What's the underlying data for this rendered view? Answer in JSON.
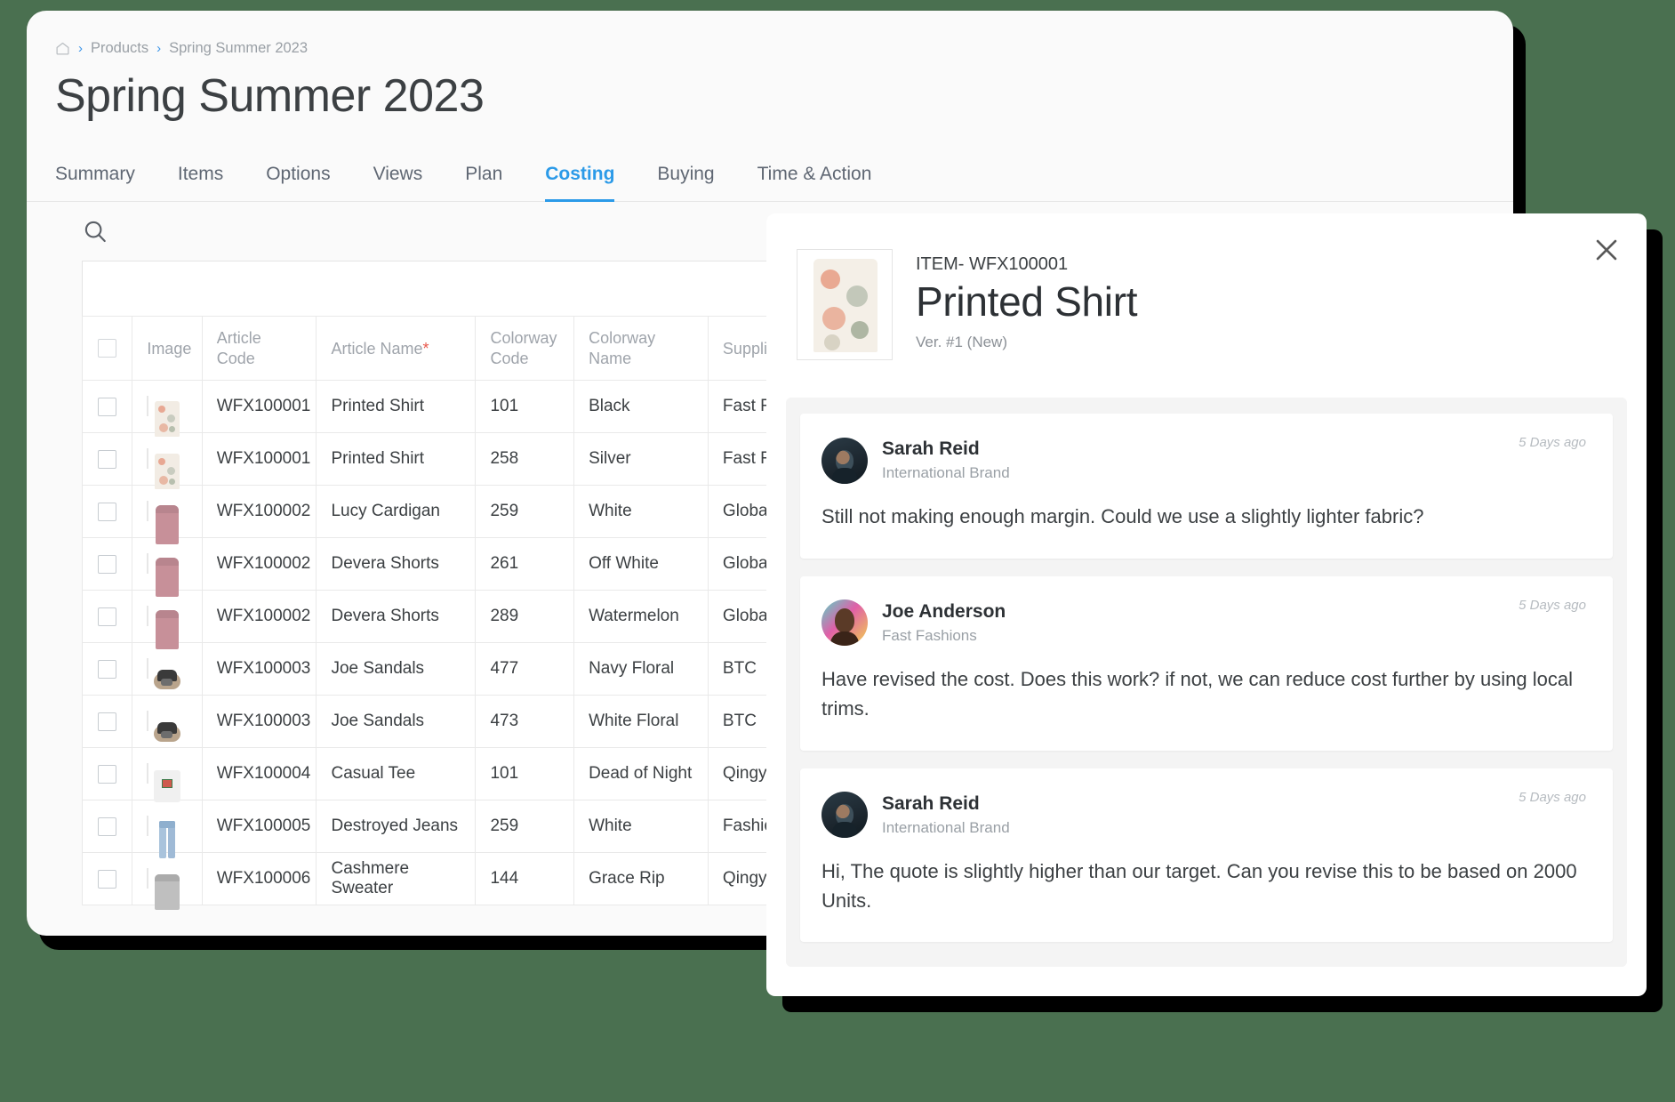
{
  "theme": {
    "background": "#4a7050",
    "accent": "#2b9ae8",
    "required_marker": "#e8584c"
  },
  "breadcrumb": {
    "home_icon": "home-icon",
    "separator": "›",
    "items": [
      "Products",
      "Spring Summer 2023"
    ]
  },
  "header": {
    "title": "Spring Summer 2023"
  },
  "tabs": [
    {
      "label": "Summary",
      "active": false
    },
    {
      "label": "Items",
      "active": false
    },
    {
      "label": "Options",
      "active": false
    },
    {
      "label": "Views",
      "active": false
    },
    {
      "label": "Plan",
      "active": false
    },
    {
      "label": "Costing",
      "active": true
    },
    {
      "label": "Buying",
      "active": false
    },
    {
      "label": "Time & Action",
      "active": false
    }
  ],
  "toolbar": {
    "search_icon": "search-icon"
  },
  "grid": {
    "columns": [
      {
        "key": "check",
        "label": ""
      },
      {
        "key": "image",
        "label": "Image"
      },
      {
        "key": "article_code",
        "label": "Article Code"
      },
      {
        "key": "article_name",
        "label": "Article Name",
        "required": true
      },
      {
        "key": "colorway_code",
        "label": "Colorway Code"
      },
      {
        "key": "colorway_name",
        "label": "Colorway Name"
      },
      {
        "key": "supplier",
        "label": "Supplier",
        "required": true
      }
    ],
    "rows": [
      {
        "thumb": "t-shirt",
        "article_code": "WFX100001",
        "article_name": "Printed Shirt",
        "colorway_code": "101",
        "colorway_name": "Black",
        "supplier": "Fast Fashions"
      },
      {
        "thumb": "t-shirt",
        "article_code": "WFX100001",
        "article_name": "Printed Shirt",
        "colorway_code": "258",
        "colorway_name": "Silver",
        "supplier": "Fast Fashions"
      },
      {
        "thumb": "t-cardigan",
        "article_code": "WFX100002",
        "article_name": "Lucy Cardigan",
        "colorway_code": "259",
        "colorway_name": "White",
        "supplier": "Global Fashions"
      },
      {
        "thumb": "t-cardigan",
        "article_code": "WFX100002",
        "article_name": "Devera Shorts",
        "colorway_code": "261",
        "colorway_name": "Off White",
        "supplier": "Global Fashions"
      },
      {
        "thumb": "t-cardigan",
        "article_code": "WFX100002",
        "article_name": "Devera Shorts",
        "colorway_code": "289",
        "colorway_name": "Watermelon",
        "supplier": "Global Fashions"
      },
      {
        "thumb": "t-sandal",
        "article_code": "WFX100003",
        "article_name": "Joe Sandals",
        "colorway_code": "477",
        "colorway_name": "Navy Floral",
        "supplier": "BTC"
      },
      {
        "thumb": "t-sandal",
        "article_code": "WFX100003",
        "article_name": "Joe Sandals",
        "colorway_code": "473",
        "colorway_name": "White Floral",
        "supplier": "BTC"
      },
      {
        "thumb": "t-tee",
        "article_code": "WFX100004",
        "article_name": "Casual Tee",
        "colorway_code": "101",
        "colorway_name": "Dead of Night",
        "supplier": "Qingya"
      },
      {
        "thumb": "t-jeans",
        "article_code": "WFX100005",
        "article_name": "Destroyed Jeans",
        "colorway_code": "259",
        "colorway_name": "White",
        "supplier": "Fashion Illusion"
      },
      {
        "thumb": "t-sweater",
        "article_code": "WFX100006",
        "article_name": "Cashmere Sweater",
        "colorway_code": "144",
        "colorway_name": "Grace Rip",
        "supplier": "Qingya"
      }
    ]
  },
  "detail_panel": {
    "close_icon": "close-icon",
    "item_code": "ITEM- WFX100001",
    "item_title": "Printed Shirt",
    "version": "Ver. #1 (New)",
    "comments": [
      {
        "avatar": "avatar-sarah",
        "name": "Sarah Reid",
        "org": "International Brand",
        "time": "5 Days ago",
        "text": "Still not making enough margin. Could we use a slightly lighter fabric?"
      },
      {
        "avatar": "avatar-joe",
        "name": "Joe Anderson",
        "org": "Fast Fashions",
        "time": "5 Days ago",
        "text": "Have revised the cost. Does this work? if not, we can reduce cost further by using local trims."
      },
      {
        "avatar": "avatar-sarah",
        "name": "Sarah Reid",
        "org": "International Brand",
        "time": "5 Days ago",
        "text": "Hi, The quote is slightly higher than our target. Can you revise this to be based on 2000 Units."
      }
    ]
  }
}
